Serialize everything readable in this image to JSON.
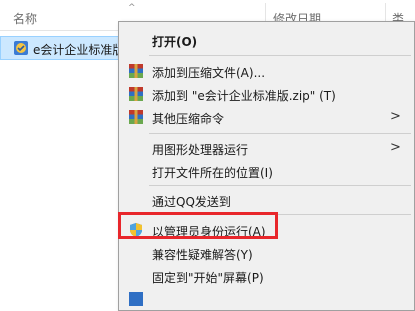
{
  "explorer": {
    "col_name": "名称",
    "col_date": "修改日期",
    "col_type": "类",
    "file_label": "e会计企业标准版"
  },
  "menu": {
    "items": [
      {
        "label": "打开(O)",
        "icon": "none",
        "bold": true
      },
      {
        "label": "添加到压缩文件(A)...",
        "icon": "winrar-icon"
      },
      {
        "label": "添加到 \"e会计企业标准版.zip\" (T)",
        "icon": "winrar-icon"
      },
      {
        "label": "其他压缩命令",
        "icon": "winrar-icon",
        "submenu": true
      },
      {
        "label": "用图形处理器运行",
        "submenu": true
      },
      {
        "label": "打开文件所在的位置(I)"
      },
      {
        "label": "通过QQ发送到"
      },
      {
        "label": "以管理员身份运行(A)",
        "icon": "uac-shield-icon"
      },
      {
        "label": "兼容性疑难解答(Y)"
      },
      {
        "label": "固定到\"开始\"屏幕(P)"
      }
    ]
  },
  "colors": {
    "menu_bg": "#f0f0f0",
    "selection_bg": "#cce8ff",
    "highlight_red": "#e8262b"
  }
}
